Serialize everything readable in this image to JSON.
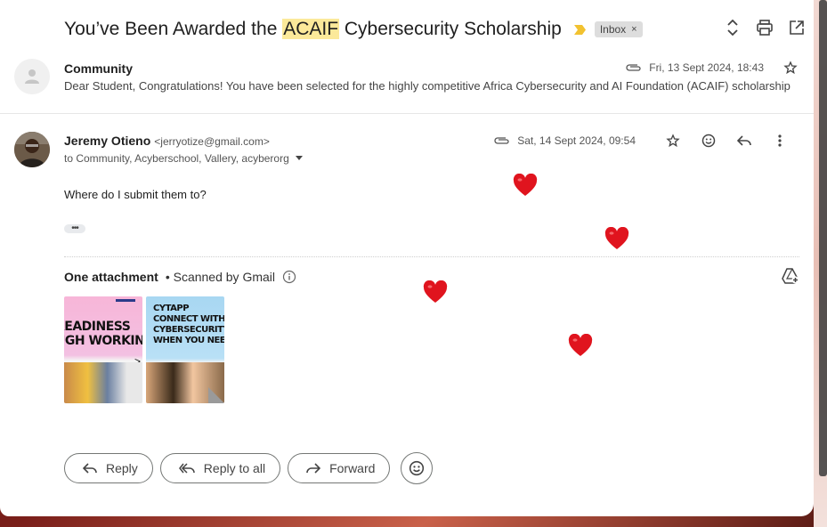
{
  "thread": {
    "subject_prefix": "You’ve Been Awarded the ",
    "subject_highlight": "ACAIF",
    "subject_suffix": " Cybersecurity Scholarship",
    "label": "Inbox",
    "label_remove": "×"
  },
  "message1": {
    "sender": "Community",
    "date": "Fri, 13 Sept 2024, 18:43",
    "snippet": "Dear Student, Congratulations! You have been selected for the highly competitive Africa Cybersecurity and AI Foundation (ACAIF) scholarship"
  },
  "message2": {
    "sender_name": "Jeremy Otieno",
    "sender_email": "<jerryotize@gmail.com>",
    "to_line": "to Community, Acyberschool, Vallery, acyberorg",
    "date": "Sat, 14 Sept 2024, 09:54",
    "body": "Where do I submit them to?",
    "trimmed_content": "•••"
  },
  "attachments": {
    "title": "One attachment",
    "scanned": "• Scanned by Gmail",
    "thumb1_text": "READINESS\nUGH WORKING",
    "thumb2_text": "CYTAPP\nCONNECT WITH\nCYBERSECURITY TALE\nWHEN YOU NEED IT T"
  },
  "actions": {
    "reply": "Reply",
    "reply_all": "Reply to all",
    "forward": "Forward"
  },
  "colors": {
    "highlight": "#fbe99a",
    "heart": "#e0141e",
    "importance_marker": "#f2c230"
  }
}
